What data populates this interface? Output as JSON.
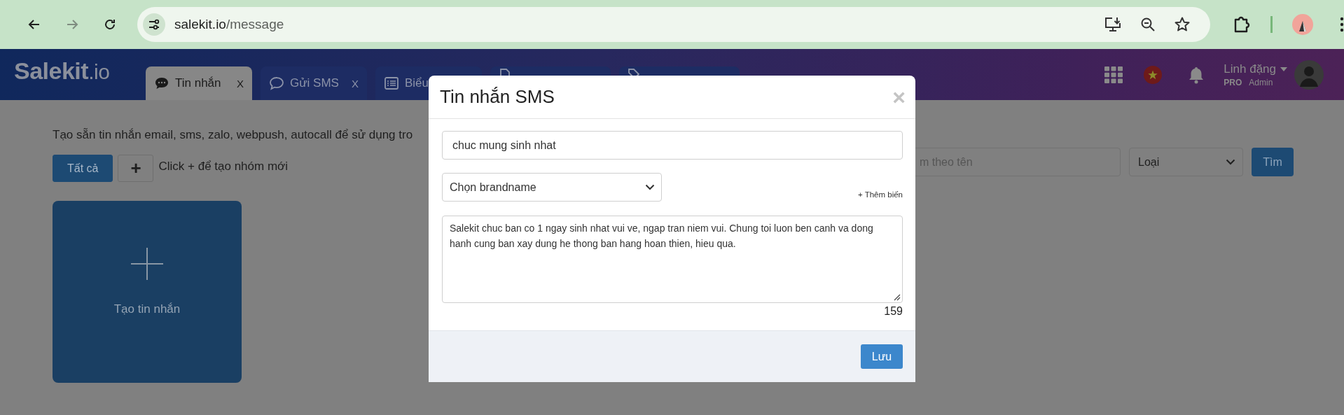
{
  "browser": {
    "url_host": "salekit.io",
    "url_path": "/message"
  },
  "header": {
    "logo": {
      "main": "Salekit",
      "suffix": ".io"
    },
    "tabs": [
      {
        "kind": "chat-filled",
        "label": "Tin nhắn",
        "close": "X",
        "selected": true
      },
      {
        "kind": "chat",
        "label": "Gửi SMS",
        "close": "X",
        "selected": false
      },
      {
        "kind": "list",
        "label": "Biểu",
        "selected": false
      },
      {
        "kind": "doc",
        "selected": false
      },
      {
        "kind": "tag",
        "selected": false
      }
    ],
    "user": {
      "name": "Linh đặng",
      "plan": "PRO",
      "role": "Admin"
    }
  },
  "page": {
    "description": "Tạo sẵn tin nhắn email, sms, zalo, webpush, autocall để sử dụng tro",
    "groups": [
      {
        "label": "Tất cả",
        "selected": true
      }
    ],
    "add_group_button": "+",
    "add_group_hint": "Click + để tạo nhóm mới",
    "create_card": {
      "label": "Tạo tin nhắn"
    },
    "search": {
      "placeholder": "m theo tên"
    },
    "type_select": {
      "value": "Loại"
    },
    "search_button": "Tìm"
  },
  "modal": {
    "title": "Tin nhắn SMS",
    "close": "×",
    "name_field": {
      "value": "chuc mung sinh nhat"
    },
    "brandname_select": {
      "value": "Chọn brandname"
    },
    "add_variable": "+ Thêm biến",
    "message": {
      "value": "Salekit chuc ban co 1 ngay sinh nhat vui ve, ngap tran niem vui. Chung toi luon ben canh va dong hanh cung ban xay dung he thong ban hang hoan thien, hieu qua."
    },
    "char_count": "159",
    "save_button": "Lưu"
  }
}
